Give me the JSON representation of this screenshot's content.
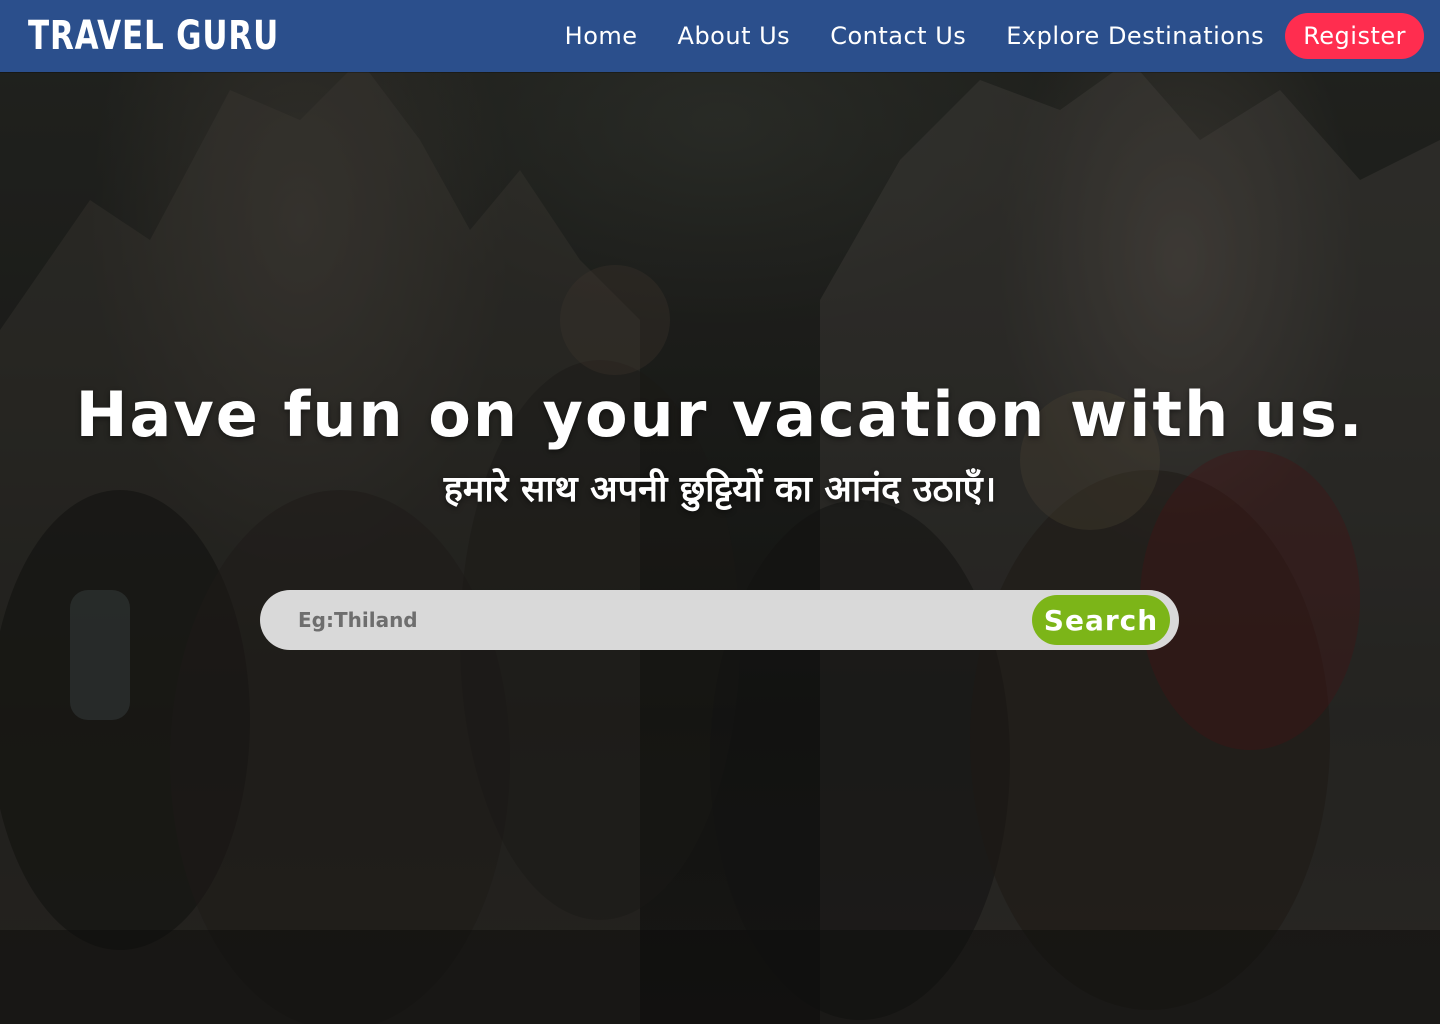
{
  "brand": {
    "name": "TRAVEL GURU"
  },
  "nav": {
    "links": [
      {
        "label": "Home"
      },
      {
        "label": "About Us"
      },
      {
        "label": "Contact Us"
      },
      {
        "label": "Explore Destinations"
      }
    ],
    "register_label": "Register"
  },
  "hero": {
    "headline": "Have fun on your vacation with us.",
    "subheadline": "हमारे साथ अपनी छुट्टियों का आनंद उठाएँ।"
  },
  "search": {
    "placeholder": "Eg:Thiland",
    "value": "",
    "button_label": "Search"
  },
  "colors": {
    "navbar": "#2b4f8c",
    "register": "#ff2d4f",
    "search_button": "#7cb518",
    "search_field": "#d9d9d9"
  }
}
